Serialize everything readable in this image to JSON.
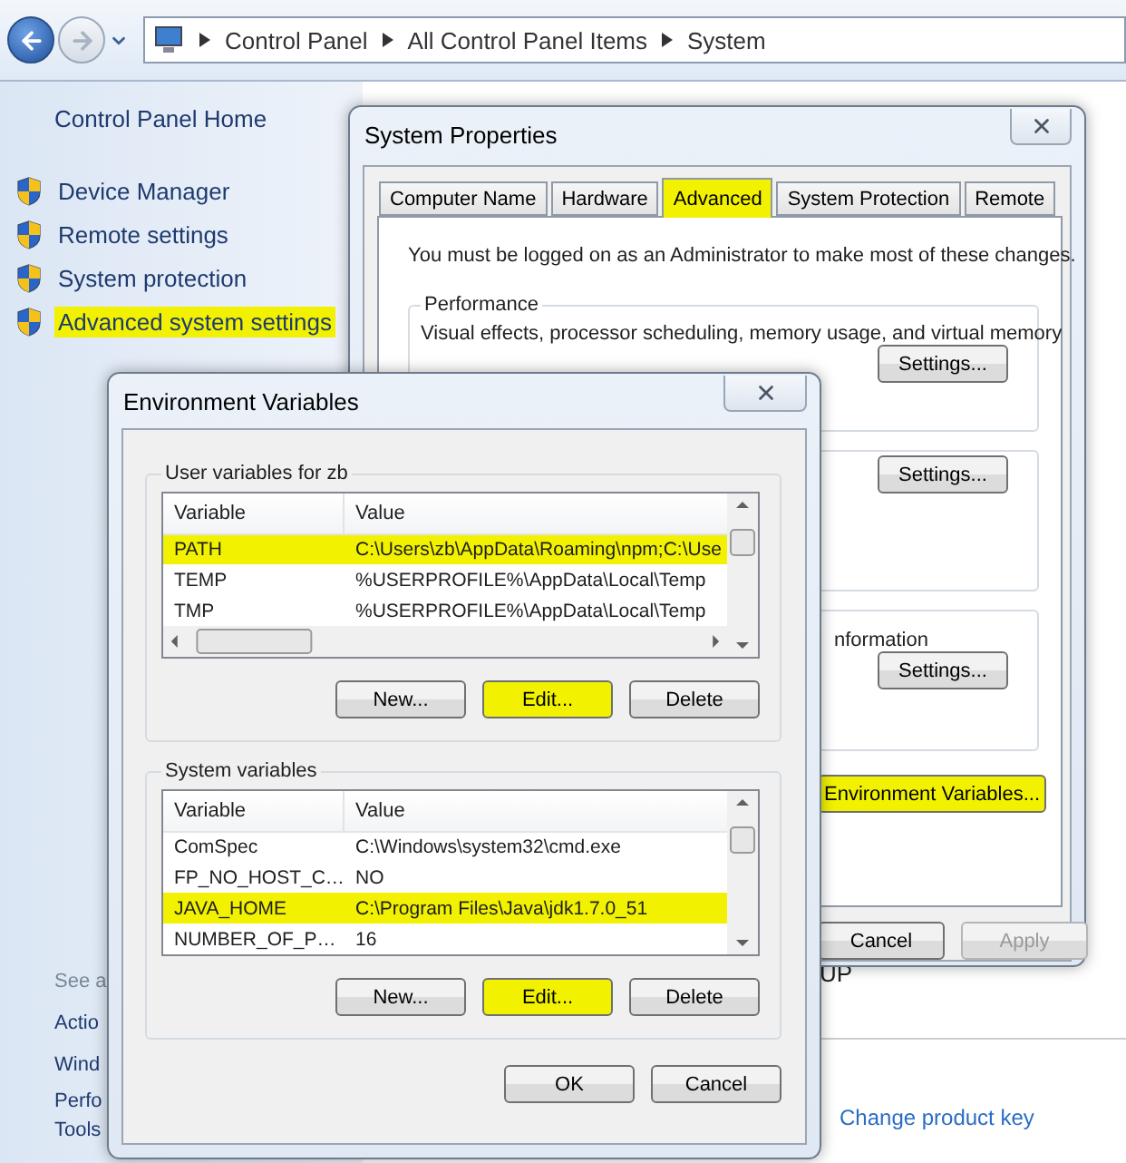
{
  "address_bar": {
    "breadcrumbs": [
      "Control Panel",
      "All Control Panel Items",
      "System"
    ]
  },
  "sidebar": {
    "home": "Control Panel Home",
    "items": [
      {
        "label": "Device Manager",
        "highlighted": false
      },
      {
        "label": "Remote settings",
        "highlighted": false
      },
      {
        "label": "System protection",
        "highlighted": false
      },
      {
        "label": "Advanced system settings",
        "highlighted": true
      }
    ],
    "see_also": "See a",
    "links": [
      "Actio",
      "Wind",
      "Perfo",
      "Tools"
    ]
  },
  "content": {
    "fragment": "UP",
    "link": "Change product key"
  },
  "system_properties": {
    "title": "System Properties",
    "tabs": [
      {
        "label": "Computer Name",
        "selected": false,
        "highlighted": false
      },
      {
        "label": "Hardware",
        "selected": false,
        "highlighted": false
      },
      {
        "label": "Advanced",
        "selected": true,
        "highlighted": true
      },
      {
        "label": "System Protection",
        "selected": false,
        "highlighted": false
      },
      {
        "label": "Remote",
        "selected": false,
        "highlighted": false
      }
    ],
    "notice": "You must be logged on as an Administrator to make most of these changes.",
    "groups": [
      {
        "label": "Performance",
        "text": "Visual effects, processor scheduling, memory usage, and virtual memory",
        "button": "Settings..."
      },
      {
        "button": "Settings..."
      },
      {
        "text": "nformation",
        "button": "Settings..."
      }
    ],
    "env_button": {
      "label": "Environment Variables...",
      "highlighted": true
    },
    "buttons": [
      {
        "label": "Cancel",
        "disabled": false
      },
      {
        "label": "Apply",
        "disabled": true
      }
    ]
  },
  "environment_variables": {
    "title": "Environment Variables",
    "groups": [
      {
        "label": "User variables for zb",
        "columns": [
          "Variable",
          "Value"
        ],
        "horizontal_scroll": true,
        "rows": [
          {
            "variable": "PATH",
            "value": "C:\\Users\\zb\\AppData\\Roaming\\npm;C:\\Use",
            "selected": false,
            "highlighted": true
          },
          {
            "variable": "TEMP",
            "value": "%USERPROFILE%\\AppData\\Local\\Temp",
            "selected": false,
            "highlighted": false
          },
          {
            "variable": "TMP",
            "value": "%USERPROFILE%\\AppData\\Local\\Temp",
            "selected": false,
            "highlighted": false
          }
        ],
        "buttons": [
          {
            "label": "New...",
            "highlighted": false
          },
          {
            "label": "Edit...",
            "highlighted": true
          },
          {
            "label": "Delete",
            "highlighted": false
          }
        ]
      },
      {
        "label": "System variables",
        "columns": [
          "Variable",
          "Value"
        ],
        "horizontal_scroll": false,
        "rows": [
          {
            "variable": "ComSpec",
            "value": "C:\\Windows\\system32\\cmd.exe",
            "selected": false,
            "highlighted": false
          },
          {
            "variable": "FP_NO_HOST_C…",
            "value": "NO",
            "selected": false,
            "highlighted": false
          },
          {
            "variable": "JAVA_HOME",
            "value": "C:\\Program Files\\Java\\jdk1.7.0_51",
            "selected": true,
            "highlighted": true
          },
          {
            "variable": "NUMBER_OF_P…",
            "value": "16",
            "selected": false,
            "highlighted": false
          }
        ],
        "buttons": [
          {
            "label": "New...",
            "highlighted": false
          },
          {
            "label": "Edit...",
            "highlighted": true
          },
          {
            "label": "Delete",
            "highlighted": false
          }
        ]
      }
    ],
    "buttons": [
      "OK",
      "Cancel"
    ]
  }
}
